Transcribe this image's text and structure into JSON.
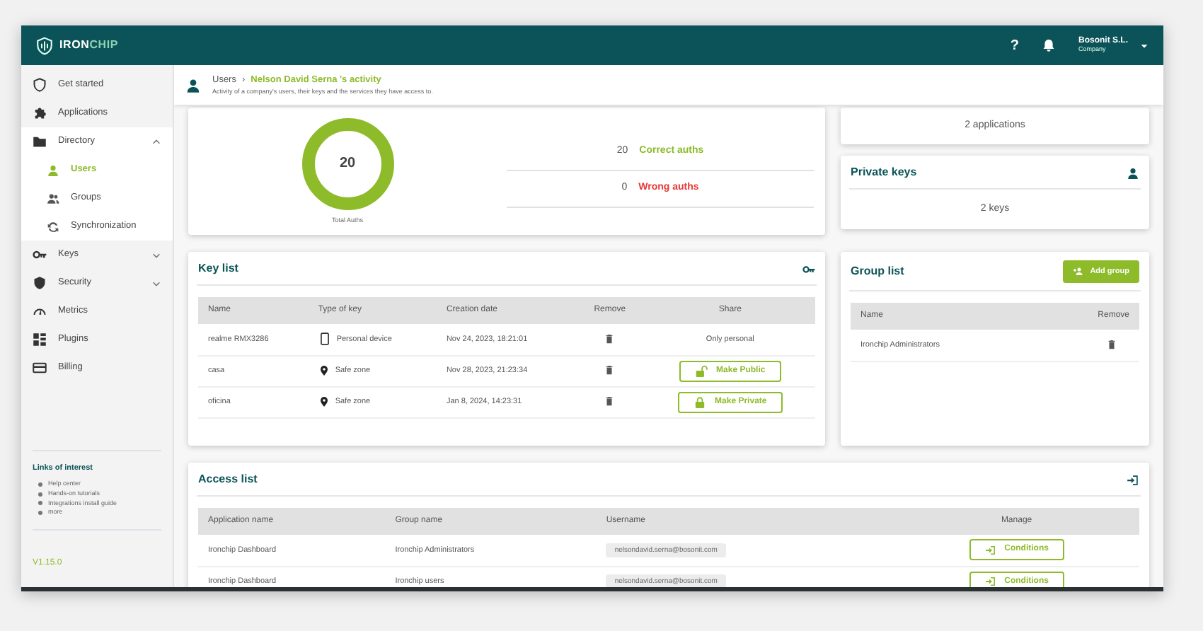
{
  "navbar": {
    "logo_primary": "IRON",
    "logo_accent": "CHIP",
    "help": "?",
    "user": {
      "name": "Bosonit S.L.",
      "role": "Company"
    }
  },
  "sidebar": {
    "items": [
      {
        "label": "Get started",
        "selected": false
      },
      {
        "label": "Applications",
        "selected": false
      },
      {
        "label": "Directory",
        "selected": true,
        "expanded": true,
        "children": [
          {
            "label": "Users",
            "selected": true
          },
          {
            "label": "Groups",
            "selected": false
          },
          {
            "label": "Synchronization",
            "selected": false
          }
        ]
      },
      {
        "label": "Keys",
        "selected": false,
        "expanded": false
      },
      {
        "label": "Security",
        "selected": false,
        "expanded": false
      },
      {
        "label": "Metrics",
        "selected": false
      },
      {
        "label": "Plugins",
        "selected": false
      },
      {
        "label": "Billing",
        "selected": false
      }
    ],
    "links_title": "Links of interest",
    "links": [
      "Help center",
      "Hands-on tutorials",
      "Integrations install guide",
      "more"
    ],
    "version": "V1.15.0"
  },
  "header": {
    "parent": "Users",
    "separator": "›",
    "current": "Nelson David Serna 's activity",
    "subtitle": "Activity of a company's users, their keys and the services they have access to."
  },
  "auths": {
    "total": "20",
    "total_label": "Total Auths",
    "rows": [
      {
        "kind": "correct",
        "count": "20",
        "label": "Correct auths"
      },
      {
        "kind": "wrong",
        "count": "0",
        "label": "Wrong auths"
      }
    ]
  },
  "applications_card": {
    "text": "2 applications"
  },
  "private_keys": {
    "title": "Private keys",
    "text": "2 keys"
  },
  "key_list": {
    "title": "Key list",
    "columns": [
      "Name",
      "Type of key",
      "Creation date",
      "Remove",
      "Share"
    ],
    "rows": [
      {
        "name": "realme RMX3286",
        "type": {
          "kind": "device",
          "label": "Personal device"
        },
        "date": "Nov 24, 2023, 18:21:01",
        "share": {
          "kind": "text",
          "label": "Only personal"
        }
      },
      {
        "name": "casa",
        "type": {
          "kind": "zone",
          "label": "Safe zone"
        },
        "date": "Nov 28, 2023, 21:23:34",
        "share": {
          "kind": "unlock",
          "label": "Make Public"
        }
      },
      {
        "name": "oficina",
        "type": {
          "kind": "zone",
          "label": "Safe zone"
        },
        "date": "Jan 8, 2024, 14:23:31",
        "share": {
          "kind": "lock",
          "label": "Make Private"
        }
      }
    ]
  },
  "group_list": {
    "title": "Group list",
    "add_button": "Add group",
    "columns": [
      "Name",
      "Remove"
    ],
    "rows": [
      {
        "name": "Ironchip Administrators"
      }
    ]
  },
  "access_list": {
    "title": "Access list",
    "columns": [
      "Application name",
      "Group name",
      "Username",
      "Manage"
    ],
    "rows": [
      {
        "application": "Ironchip Dashboard",
        "group": "Ironchip Administrators",
        "username": "nelsondavid.serna@bosonit.com",
        "button": "Conditions"
      },
      {
        "application": "Ironchip Dashboard",
        "group": "Ironchip users",
        "username": "nelsondavid.serna@bosonit.com",
        "button": "Conditions"
      }
    ]
  }
}
